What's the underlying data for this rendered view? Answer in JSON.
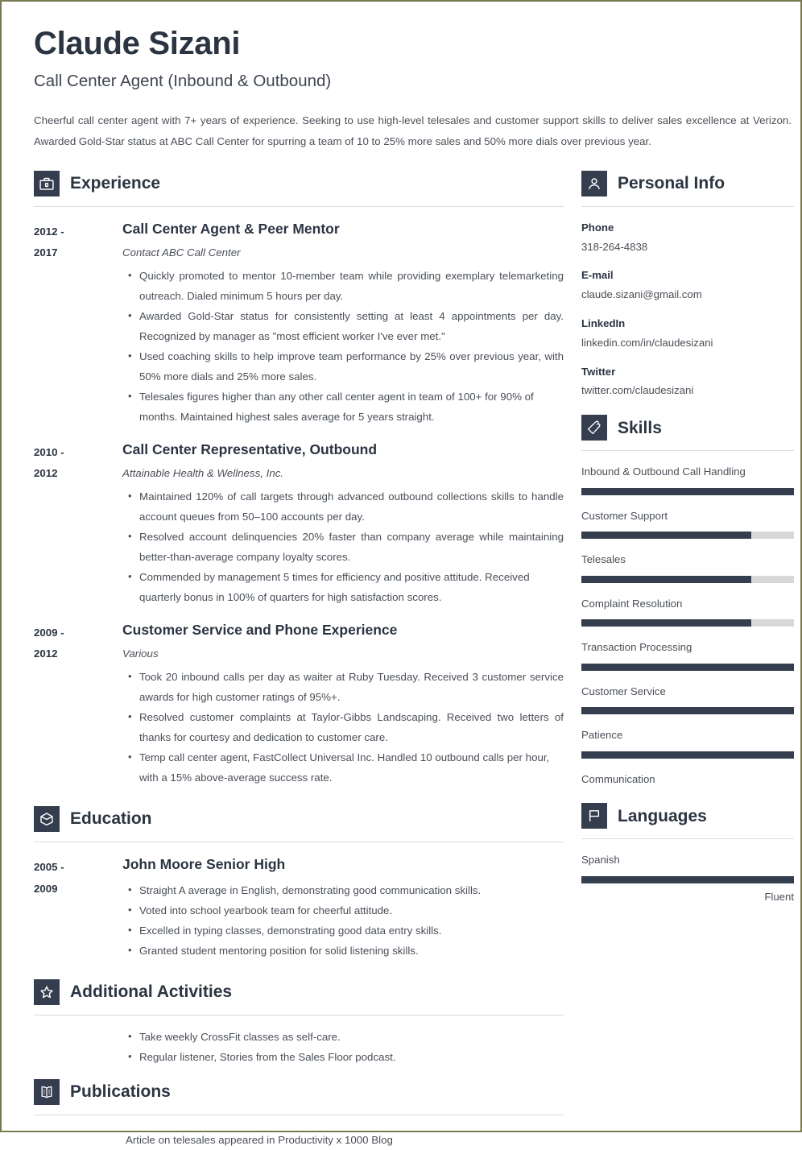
{
  "theme": {
    "accent_dark": "#343e4e",
    "text_dark": "#2b3441",
    "text_body": "#4a4f57",
    "rule": "#dcdcdc",
    "track": "#d8d8d8",
    "page_border": "#7a7a52"
  },
  "header": {
    "name": "Claude Sizani",
    "job_title": "Call Center Agent (Inbound & Outbound)",
    "summary": "Cheerful call center agent with 7+ years of experience. Seeking to use high-level telesales and customer support skills to deliver sales excellence at Verizon. Awarded Gold-Star status at ABC Call Center for spurring a team of 10 to 25% more sales and 50% more dials over previous year."
  },
  "sections": {
    "experience": {
      "title": "Experience",
      "icon": "briefcase-icon",
      "entries": [
        {
          "dates": "2012 - 2017",
          "date_line1": "2012 -",
          "date_line2": "2017",
          "role": "Call Center Agent & Peer Mentor",
          "org": "Contact ABC Call Center",
          "bullets": [
            "Quickly promoted to mentor 10-member team while providing exemplary telemarketing outreach. Dialed minimum 5 hours per day.",
            "Awarded Gold-Star status for consistently setting at least 4 appointments per day. Recognized by manager as \"most efficient worker I've ever met.\"",
            "Used coaching skills to help improve team performance by 25% over previous year, with 50% more dials and 25% more sales.",
            "Telesales figures higher than any other call center agent in team of 100+ for 90% of months. Maintained highest sales average for 5 years straight."
          ]
        },
        {
          "dates": "2010 - 2012",
          "date_line1": "2010 -",
          "date_line2": "2012",
          "role": "Call Center Representative, Outbound",
          "org": "Attainable Health & Wellness, Inc.",
          "bullets": [
            "Maintained 120% of call targets through advanced outbound collections skills to handle account queues from 50–100 accounts per day.",
            "Resolved account delinquencies 20% faster than company average while maintaining better-than-average company loyalty scores.",
            "Commended by management 5 times for efficiency and positive attitude. Received quarterly bonus in 100% of quarters for high satisfaction scores."
          ]
        },
        {
          "dates": "2009 - 2012",
          "date_line1": "2009 -",
          "date_line2": "2012",
          "role": "Customer Service and Phone Experience",
          "org": "Various",
          "bullets": [
            "Took 20 inbound calls per day as waiter at Ruby Tuesday. Received 3 customer service awards for high customer ratings of 95%+.",
            "Resolved customer complaints at Taylor-Gibbs Landscaping. Received two letters of thanks for courtesy and dedication to customer care.",
            "Temp call center agent, FastCollect Universal Inc. Handled 10 outbound calls per hour, with a 15% above-average success rate."
          ]
        }
      ]
    },
    "education": {
      "title": "Education",
      "icon": "graduation-cap-icon",
      "entries": [
        {
          "dates": "2005 - 2009",
          "date_line1": "2005 -",
          "date_line2": "2009",
          "role": "John Moore Senior High",
          "org": "",
          "bullets": [
            "Straight A average in English, demonstrating good communication skills.",
            "Voted into school yearbook team for cheerful attitude.",
            "Excelled in typing classes, demonstrating good data entry skills.",
            "Granted student mentoring position for solid listening skills."
          ]
        }
      ]
    },
    "activities": {
      "title": "Additional Activities",
      "icon": "star-icon",
      "bullets": [
        "Take weekly CrossFit classes as self-care.",
        "Regular listener, Stories from the Sales Floor podcast."
      ]
    },
    "publications": {
      "title": "Publications",
      "icon": "open-book-icon",
      "text": "Article on telesales appeared in Productivity x 1000 Blog"
    },
    "personal_info": {
      "title": "Personal Info",
      "icon": "person-icon",
      "items": [
        {
          "label": "Phone",
          "value": "318-264-4838"
        },
        {
          "label": "E-mail",
          "value": "claude.sizani@gmail.com"
        },
        {
          "label": "LinkedIn",
          "value": "linkedin.com/in/claudesizani"
        },
        {
          "label": "Twitter",
          "value": "twitter.com/claudesizani"
        }
      ]
    },
    "skills": {
      "title": "Skills",
      "icon": "puzzle-piece-icon",
      "items": [
        {
          "name": "Inbound & Outbound Call Handling",
          "level": 100,
          "has_bar": true
        },
        {
          "name": "Customer Support",
          "level": 80,
          "has_bar": true
        },
        {
          "name": "Telesales",
          "level": 80,
          "has_bar": true
        },
        {
          "name": "Complaint Resolution",
          "level": 80,
          "has_bar": true
        },
        {
          "name": "Transaction Processing",
          "level": 100,
          "has_bar": true
        },
        {
          "name": "Customer Service",
          "level": 100,
          "has_bar": true
        },
        {
          "name": "Patience",
          "level": 100,
          "has_bar": true
        },
        {
          "name": "Communication",
          "level": 0,
          "has_bar": false
        }
      ]
    },
    "languages": {
      "title": "Languages",
      "icon": "flag-icon",
      "items": [
        {
          "name": "Spanish",
          "level": 100,
          "level_label": "Fluent"
        }
      ]
    }
  }
}
